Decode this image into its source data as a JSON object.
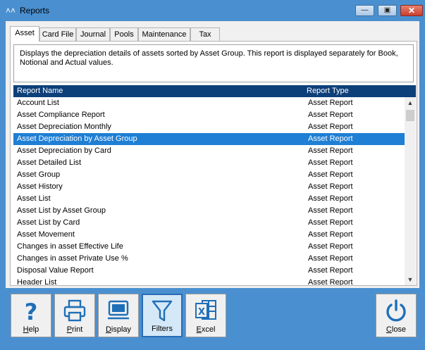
{
  "window": {
    "title": "Reports"
  },
  "tabs": [
    {
      "label": "Asset",
      "active": true
    },
    {
      "label": "Card File"
    },
    {
      "label": "Journal"
    },
    {
      "label": "Pools"
    },
    {
      "label": "Maintenance"
    },
    {
      "label": "Tax"
    }
  ],
  "description": "Displays the depreciation details of assets sorted by Asset Group.  This report is displayed separately for Book, Notional and Actual values.",
  "list": {
    "columns": [
      "Report Name",
      "Report Type"
    ],
    "rows": [
      {
        "name": "Account List",
        "type": "Asset Report"
      },
      {
        "name": "Asset Compliance Report",
        "type": "Asset Report"
      },
      {
        "name": "Asset Depreciation Monthly",
        "type": "Asset Report"
      },
      {
        "name": "Asset Depreciation by Asset Group",
        "type": "Asset Report",
        "selected": true
      },
      {
        "name": "Asset Depreciation by Card",
        "type": "Asset Report"
      },
      {
        "name": "Asset Detailed List",
        "type": "Asset Report"
      },
      {
        "name": "Asset Group",
        "type": "Asset Report"
      },
      {
        "name": "Asset History",
        "type": "Asset Report"
      },
      {
        "name": "Asset List",
        "type": "Asset Report"
      },
      {
        "name": "Asset List by Asset Group",
        "type": "Asset Report"
      },
      {
        "name": "Asset List by Card",
        "type": "Asset Report"
      },
      {
        "name": "Asset Movement",
        "type": "Asset Report"
      },
      {
        "name": "Changes in asset Effective Life",
        "type": "Asset Report"
      },
      {
        "name": "Changes in asset Private Use %",
        "type": "Asset Report"
      },
      {
        "name": "Disposal Value Report",
        "type": "Asset Report"
      },
      {
        "name": "Header List",
        "type": "Asset Report"
      }
    ]
  },
  "toolbar": {
    "help": {
      "mnemonic": "H",
      "rest": "elp"
    },
    "print": {
      "mnemonic": "P",
      "rest": "rint"
    },
    "display": {
      "mnemonic": "D",
      "rest": "isplay"
    },
    "filters": {
      "label": "Filters"
    },
    "excel": {
      "mnemonic": "E",
      "rest": "xcel"
    },
    "close": {
      "mnemonic": "C",
      "rest": "lose"
    }
  },
  "colors": {
    "frame": "#4a90d0",
    "header": "#0d3f79",
    "selection": "#1e7fd4",
    "icon_blue": "#1e6fb8"
  }
}
